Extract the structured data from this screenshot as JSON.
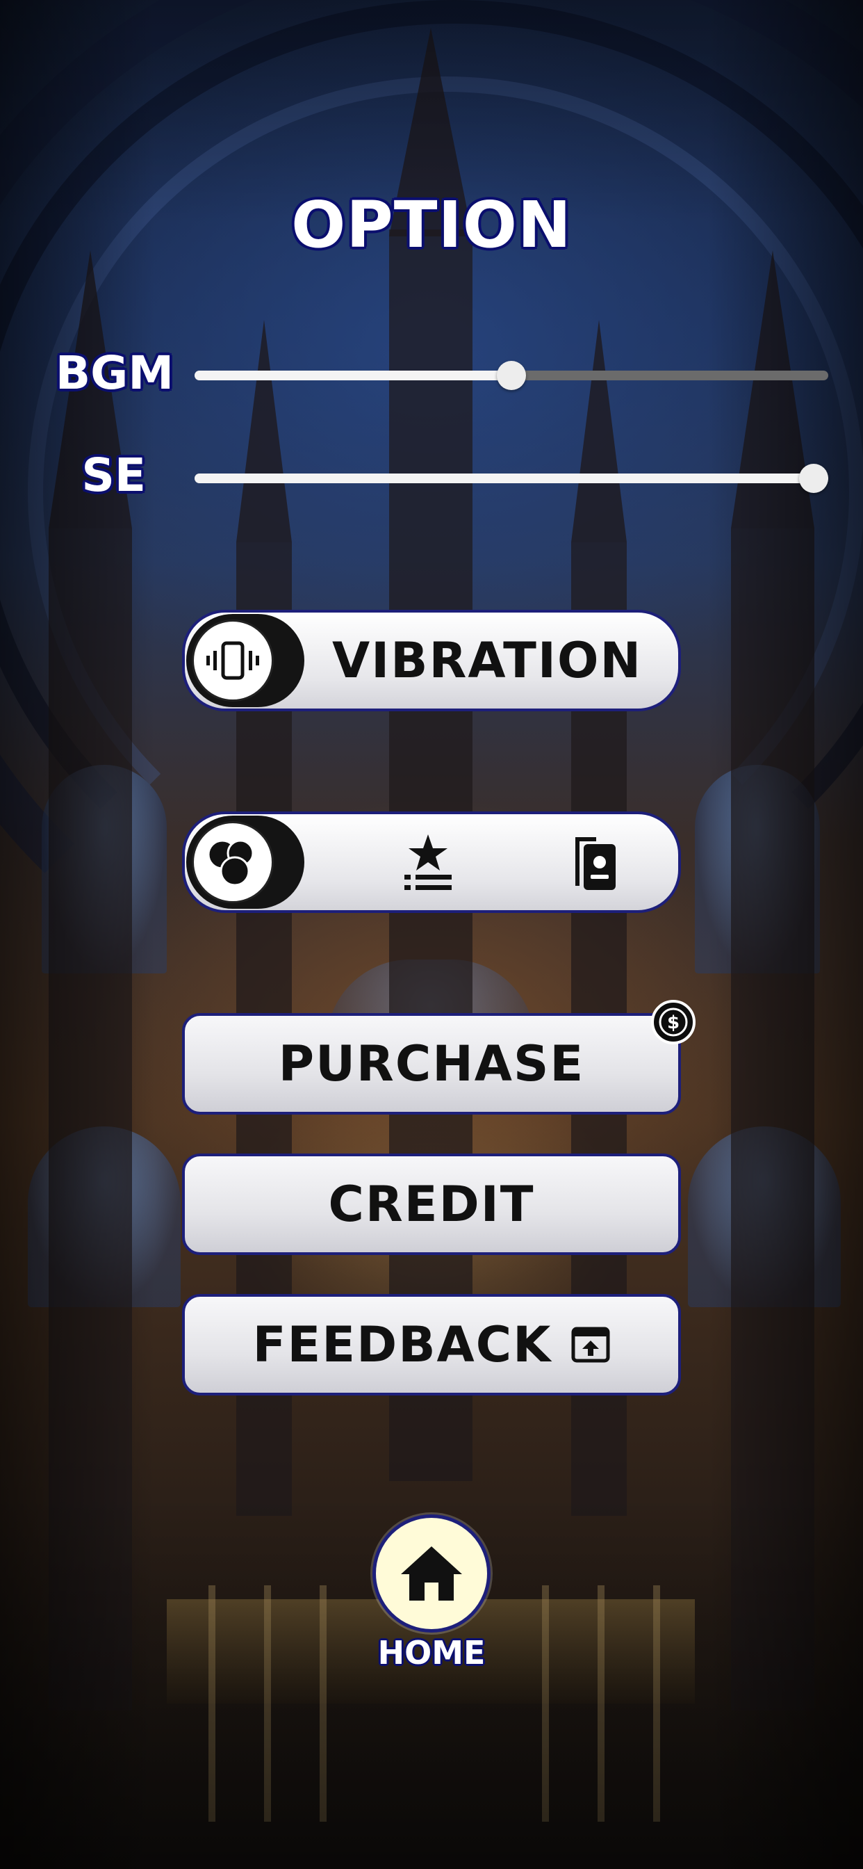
{
  "screen": {
    "title": "OPTION"
  },
  "audio": {
    "bgm_label": "BGM",
    "bgm_level": 0.5,
    "se_label": "SE",
    "se_level": 1.0
  },
  "vibration": {
    "label": "VIBRATION",
    "toggle_icon": "vibrate-icon"
  },
  "mode_toggle": {
    "toggle_icon": "bubbles-icon",
    "option_icons": [
      "ranking-icon",
      "cards-icon"
    ]
  },
  "menu": {
    "purchase_label": "PURCHASE",
    "purchase_badge_icon": "dollar-coin-icon",
    "credit_label": "CREDIT",
    "feedback_label": "FEEDBACK",
    "feedback_icon": "external-open-icon"
  },
  "nav": {
    "home_label": "HOME",
    "home_icon": "house-icon"
  },
  "colors": {
    "outline_navy": "#0b0f6e",
    "button_border": "#1d1f7a",
    "home_button_fill": "#fffbd8",
    "slider_fill": "#f4f4f4",
    "slider_track": "#6b6b6b"
  }
}
